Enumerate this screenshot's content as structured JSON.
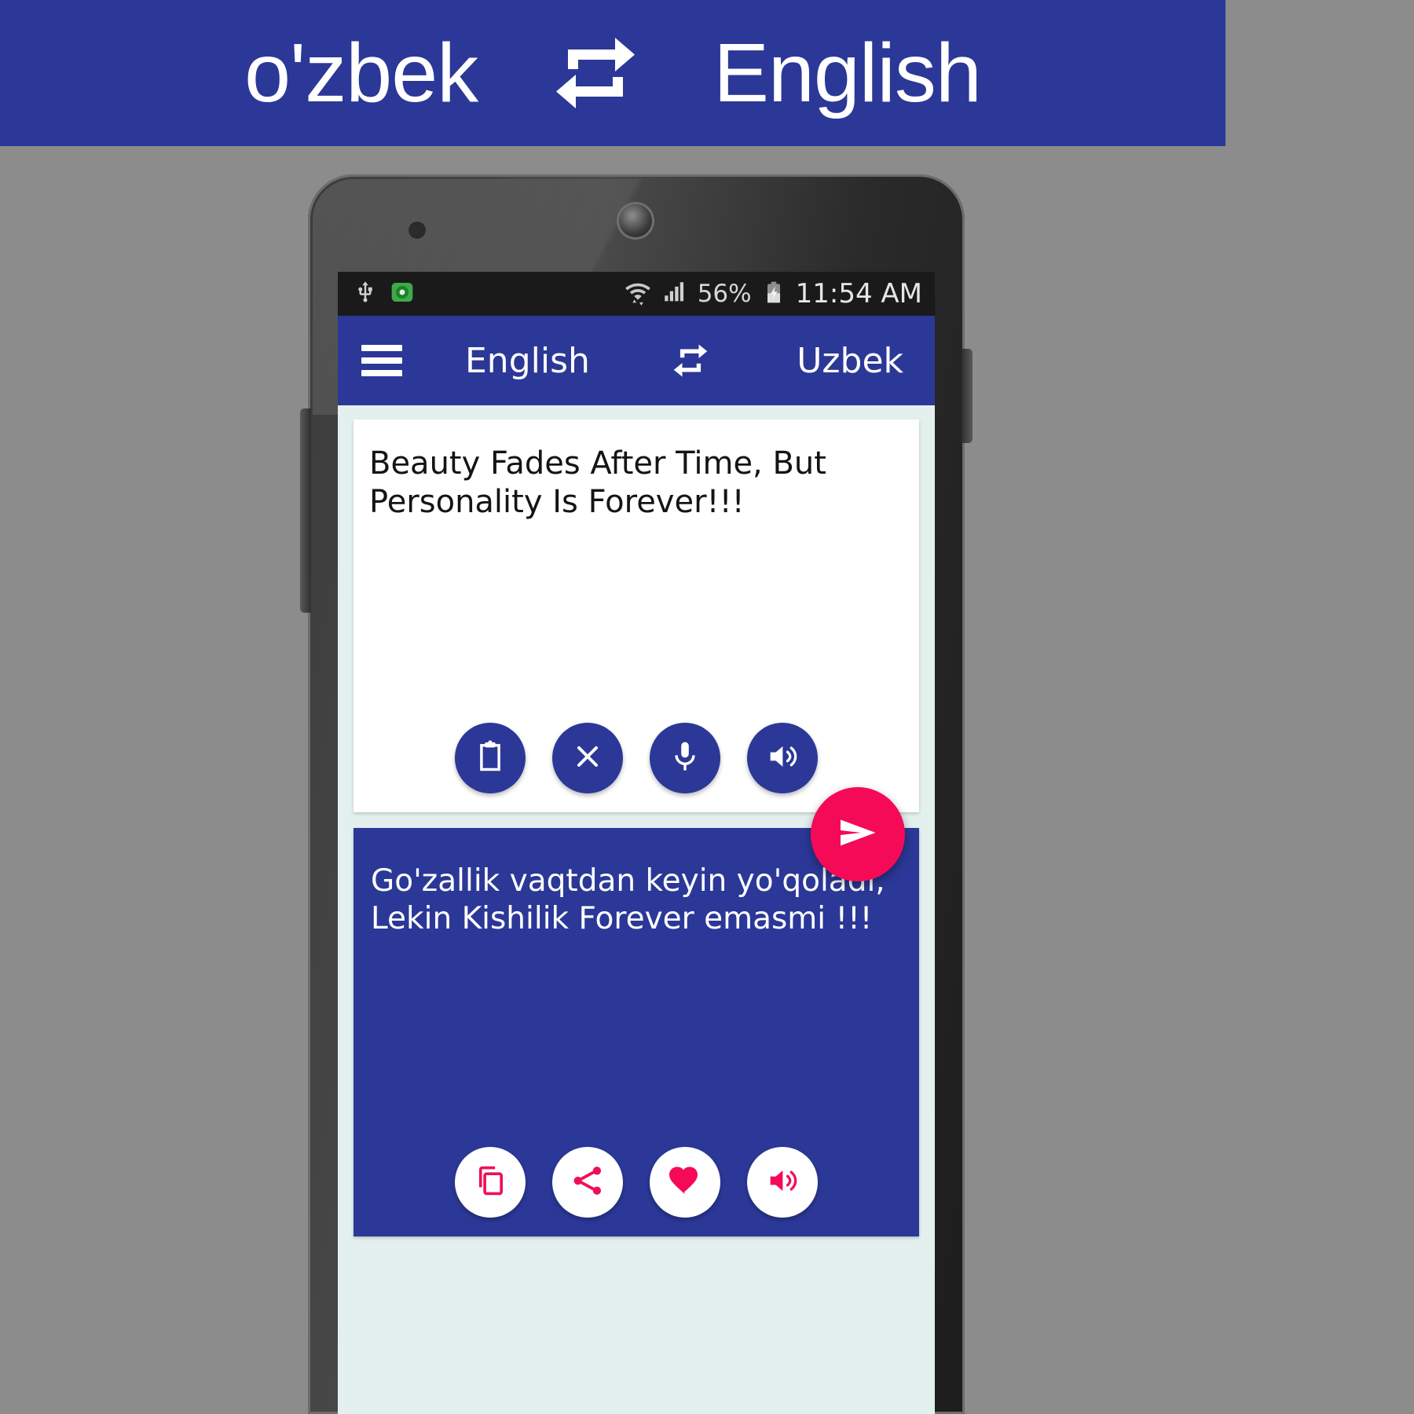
{
  "promo": {
    "source_language": "o'zbek",
    "target_language": "English",
    "swap_icon": "swap-repeat-icon",
    "background_color": "#2b3897",
    "text_color": "#ffffff"
  },
  "device": {
    "status_bar": {
      "usb_icon": "usb-icon",
      "app_icon": "app-notification-icon",
      "wifi_icon": "wifi-transfer-icon",
      "signal_icon": "cellular-signal-icon",
      "battery_percent": "56%",
      "battery_icon": "battery-charging-icon",
      "time": "11:54 AM"
    }
  },
  "app": {
    "toolbar": {
      "menu_icon": "hamburger-menu-icon",
      "source_language": "English",
      "swap_icon": "swap-repeat-icon",
      "target_language": "Uzbek",
      "background_color": "#2b3897"
    },
    "input_card": {
      "text": "Beauty Fades After Time, But\nPersonality Is Forever!!!",
      "actions": [
        {
          "name": "paste-button",
          "icon": "clipboard-icon"
        },
        {
          "name": "clear-button",
          "icon": "close-x-icon"
        },
        {
          "name": "voice-input-button",
          "icon": "microphone-icon"
        },
        {
          "name": "speak-source-button",
          "icon": "speaker-volume-icon"
        }
      ]
    },
    "send_button": {
      "name": "translate-send-button",
      "icon": "send-paper-plane-icon",
      "color": "#f50a57"
    },
    "output_card": {
      "text": "Go'zallik vaqtdan keyin yo'qoladi,\nLekin Kishilik Forever emasmi !!!",
      "background_color": "#2b3897",
      "actions": [
        {
          "name": "copy-button",
          "icon": "copy-icon"
        },
        {
          "name": "share-button",
          "icon": "share-icon"
        },
        {
          "name": "favorite-button",
          "icon": "heart-icon"
        },
        {
          "name": "speak-result-button",
          "icon": "speaker-volume-icon"
        }
      ]
    }
  }
}
